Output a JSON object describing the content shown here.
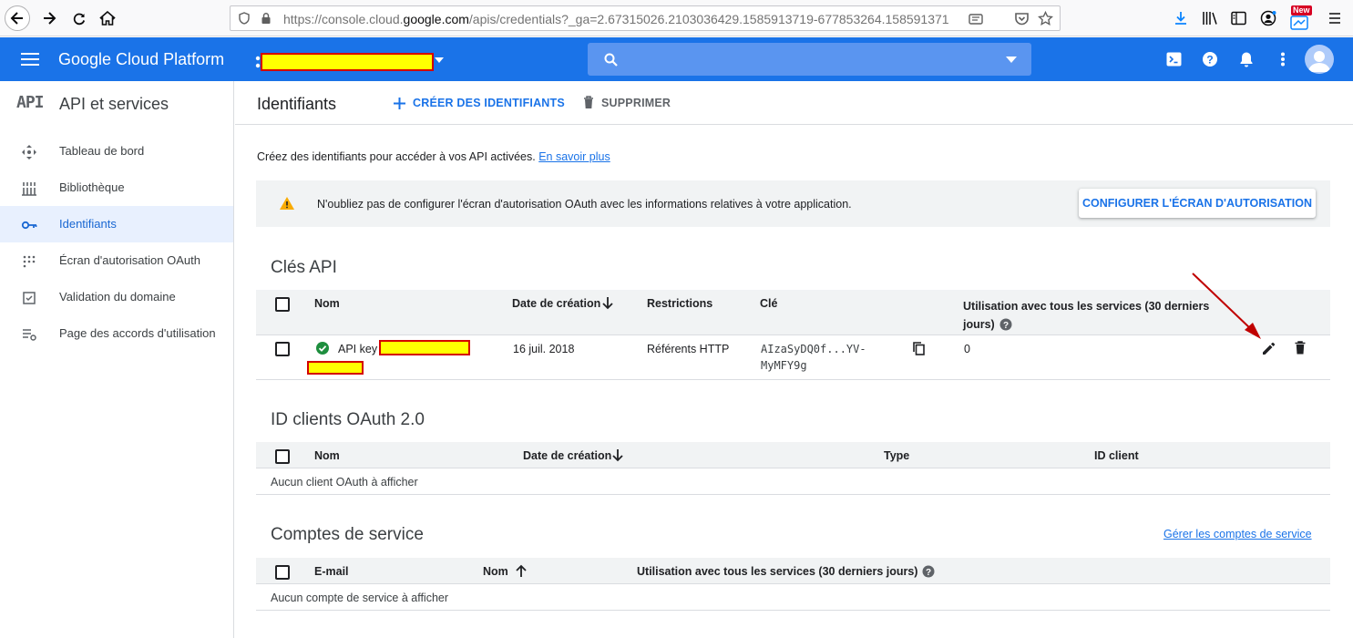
{
  "browser": {
    "url_prefix": "https://console.cloud.",
    "url_domain": "google.com",
    "url_suffix": "/apis/credentials?_ga=2.67315026.2103036429.1585913719-677853264.158591371",
    "new_badge": "New"
  },
  "header": {
    "app_title": "Google Cloud Platform"
  },
  "sidebar": {
    "logo": "API",
    "title": "API et services",
    "items": [
      {
        "label": "Tableau de bord",
        "icon": "dashboard-icon"
      },
      {
        "label": "Bibliothèque",
        "icon": "library-icon"
      },
      {
        "label": "Identifiants",
        "icon": "key-icon",
        "active": true
      },
      {
        "label": "Écran d'autorisation OAuth",
        "icon": "consent-icon"
      },
      {
        "label": "Validation du domaine",
        "icon": "domain-check-icon"
      },
      {
        "label": "Page des accords d'utilisation",
        "icon": "agreements-icon"
      }
    ]
  },
  "toolbar": {
    "page_title": "Identifiants",
    "create_label": "CRÉER DES IDENTIFIANTS",
    "delete_label": "SUPPRIMER"
  },
  "intro": {
    "text": "Créez des identifiants pour accéder à vos API activées.",
    "link": "En savoir plus"
  },
  "banner": {
    "text": "N'oubliez pas de configurer l'écran d'autorisation OAuth avec les informations relatives à votre application.",
    "button": "CONFIGURER L'ÉCRAN D'AUTORISATION"
  },
  "api_keys": {
    "title": "Clés API",
    "columns": {
      "name": "Nom",
      "created": "Date de création",
      "restrictions": "Restrictions",
      "key": "Clé",
      "usage_line1": "Utilisation avec tous les services (30 derniers",
      "usage_line2": "jours)"
    },
    "rows": [
      {
        "name": "API key",
        "created": "16 juil. 2018",
        "restrictions": "Référents HTTP",
        "key_line1": "AIzaSyDQ0f...YV-",
        "key_line2": "MyMFY9g",
        "usage": "0"
      }
    ]
  },
  "oauth_clients": {
    "title": "ID clients OAuth 2.0",
    "columns": {
      "name": "Nom",
      "created": "Date de création",
      "type": "Type",
      "client_id": "ID client"
    },
    "empty": "Aucun client OAuth à afficher"
  },
  "service_accounts": {
    "title": "Comptes de service",
    "manage_link": "Gérer les comptes de service",
    "columns": {
      "email": "E-mail",
      "name": "Nom",
      "usage": "Utilisation avec tous les services (30 derniers jours)"
    },
    "empty": "Aucun compte de service à afficher"
  },
  "colors": {
    "brand_blue": "#1a73e8",
    "annotation_red": "#c00000",
    "redaction_yellow": "#ffff00",
    "success_green": "#1e8e3e",
    "warning_amber": "#f9ab00"
  }
}
